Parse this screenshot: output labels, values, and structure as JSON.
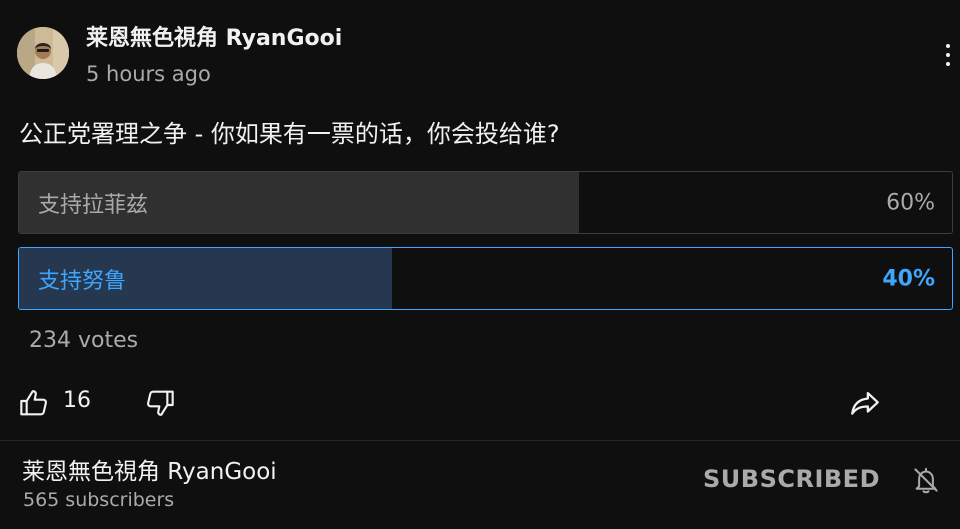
{
  "post": {
    "channel_name": "莱恩無色視角 RyanGooi",
    "time": "5 hours ago",
    "question": "公正党署理之争 - 你如果有一票的话，你会投给谁?"
  },
  "poll": {
    "options": [
      {
        "label": "支持拉菲兹",
        "percent_text": "60%",
        "percent": 60,
        "selected": false
      },
      {
        "label": "支持努鲁",
        "percent_text": "40%",
        "percent": 40,
        "selected": true
      }
    ],
    "votes": "234 votes"
  },
  "actions": {
    "like_count": "16"
  },
  "footer": {
    "channel_name": "莱恩無色視角 RyanGooi",
    "subscribers": "565 subscribers",
    "subscribed_label": "SUBSCRIBED"
  },
  "icons": {
    "more": "more-vert-icon",
    "like": "thumbs-up-icon",
    "dislike": "thumbs-down-icon",
    "share": "share-icon",
    "bell": "bell-off-icon"
  },
  "colors": {
    "background": "#0f0f0f",
    "accent": "#3ea6ff",
    "muted_text": "#aaaaaa"
  }
}
